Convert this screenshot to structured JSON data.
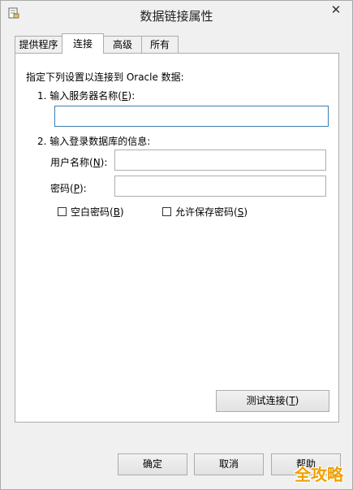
{
  "window": {
    "title": "数据链接属性",
    "close_glyph": "✕"
  },
  "tabs": [
    {
      "label": "提供程序",
      "active": false
    },
    {
      "label": "连接",
      "active": true
    },
    {
      "label": "高级",
      "active": false
    },
    {
      "label": "所有",
      "active": false
    }
  ],
  "connection": {
    "intro": "指定下列设置以连接到 Oracle 数据:",
    "step1_label": "1. 输入服务器名称(",
    "step1_key": "E",
    "step1_suffix": "):",
    "server_name_value": "",
    "step2_label": "2. 输入登录数据库的信息:",
    "username_label": "用户名称(",
    "username_key": "N",
    "username_suffix": "):",
    "username_value": "",
    "password_label": "密码(",
    "password_key": "P",
    "password_suffix": "):",
    "password_value": "",
    "blank_password_label": "空白密码(",
    "blank_password_key": "B",
    "blank_password_suffix": ")",
    "blank_password_checked": false,
    "save_password_label": "允许保存密码(",
    "save_password_key": "S",
    "save_password_suffix": ")",
    "save_password_checked": false,
    "test_connection_label": "测试连接(",
    "test_connection_key": "T",
    "test_connection_suffix": ")"
  },
  "footer": {
    "ok_label": "确定",
    "cancel_label": "取消",
    "help_label": "帮助"
  },
  "watermark": {
    "text": "全攻略",
    "color": "#f0a000"
  },
  "icons": {
    "app": "data-link-icon",
    "close": "close-icon"
  }
}
